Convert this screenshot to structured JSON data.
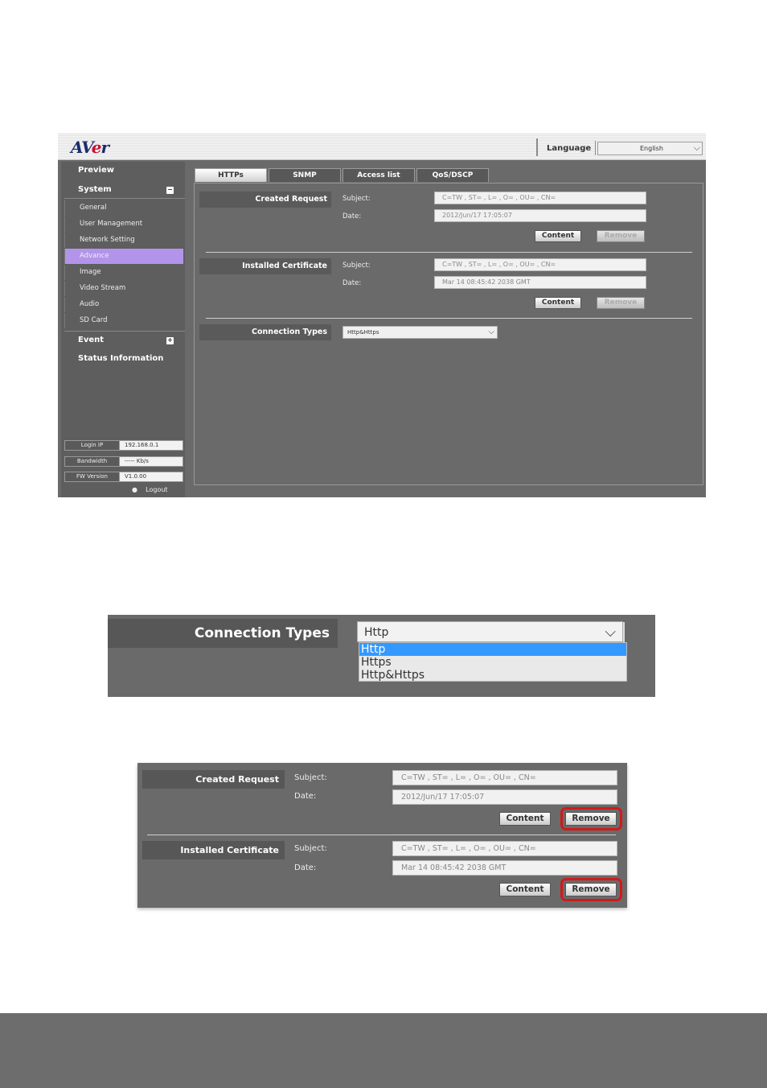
{
  "header": {
    "logo_prefix": "AV",
    "logo_e": "e",
    "logo_suffix": "r",
    "language_label": "Language",
    "language_value": "English"
  },
  "sidebar": {
    "preview": "Preview",
    "system": "System",
    "system_toggle": "−",
    "items": [
      {
        "label": "General"
      },
      {
        "label": "User Management"
      },
      {
        "label": "Network Setting"
      },
      {
        "label": "Advance"
      },
      {
        "label": "Image"
      },
      {
        "label": "Video Stream"
      },
      {
        "label": "Audio"
      },
      {
        "label": "SD Card"
      }
    ],
    "event": "Event",
    "event_toggle": "+",
    "status_info": "Status Information",
    "info": {
      "login_ip_label": "Login IP",
      "login_ip_value": "192.168.0.1",
      "bandwidth_label": "Bandwidth",
      "bandwidth_value": "----- Kb/s",
      "fw_label": "FW Version",
      "fw_value": "V1.0.00"
    },
    "logout": "Logout"
  },
  "tabs": [
    {
      "label": "HTTPs"
    },
    {
      "label": "SNMP"
    },
    {
      "label": "Access list"
    },
    {
      "label": "QoS/DSCP"
    }
  ],
  "https": {
    "created_request": {
      "label": "Created Request",
      "subject_label": "Subject:",
      "subject_value": "C=TW , ST= , L= , O= , OU= , CN=",
      "date_label": "Date:",
      "date_value": "2012/Jun/17 17:05:07"
    },
    "installed_certificate": {
      "label": "Installed Certificate",
      "subject_label": "Subject:",
      "subject_value": "C=TW , ST= , L= , O= , OU= , CN=",
      "date_label": "Date:",
      "date_value": "Mar 14 08:45:42 2038 GMT"
    },
    "content_button": "Content",
    "remove_button": "Remove",
    "connection_types_label": "Connection Types",
    "connection_types_value": "Http&Https"
  },
  "zoom_connection": {
    "label": "Connection Types",
    "current_value": "Http",
    "options": [
      {
        "label": "Http",
        "selected": true
      },
      {
        "label": "Https",
        "selected": false
      },
      {
        "label": "Http&Https",
        "selected": false
      }
    ]
  },
  "zoom_certificates": {
    "created_request_label": "Created Request",
    "installed_certificate_label": "Installed Certificate",
    "subject_label": "Subject:",
    "date_label": "Date:",
    "created_subject": "C=TW , ST= , L= , O= , OU= , CN=",
    "created_date": "2012/Jun/17 17:05:07",
    "installed_subject": "C=TW , ST= , L= , O= , OU= , CN=",
    "installed_date": "Mar 14 08:45:42 2038 GMT",
    "content_button": "Content",
    "remove_button": "Remove",
    "highlight_color": "#d11a1a"
  }
}
